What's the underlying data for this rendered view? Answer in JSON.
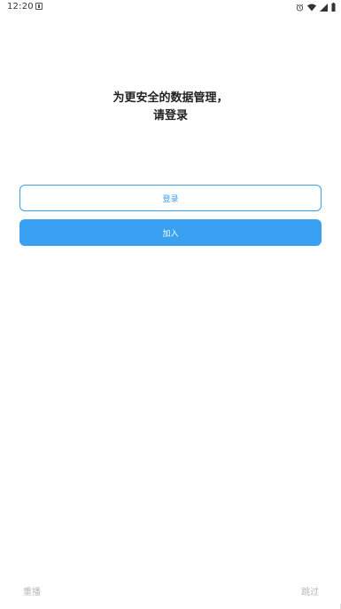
{
  "status_bar": {
    "time": "12:20",
    "icons": [
      "notification-icon",
      "alarm-icon",
      "wifi-icon",
      "signal-icon",
      "battery-icon"
    ]
  },
  "headline": {
    "line1": "为更安全的数据管理，",
    "line2": "请登录"
  },
  "buttons": {
    "login_label": "登录",
    "join_label": "加入"
  },
  "footer": {
    "replay_label": "重播",
    "skip_label": "跳过"
  },
  "colors": {
    "accent": "#3aa0f2",
    "text": "#222222",
    "muted": "#b8b8b8"
  }
}
